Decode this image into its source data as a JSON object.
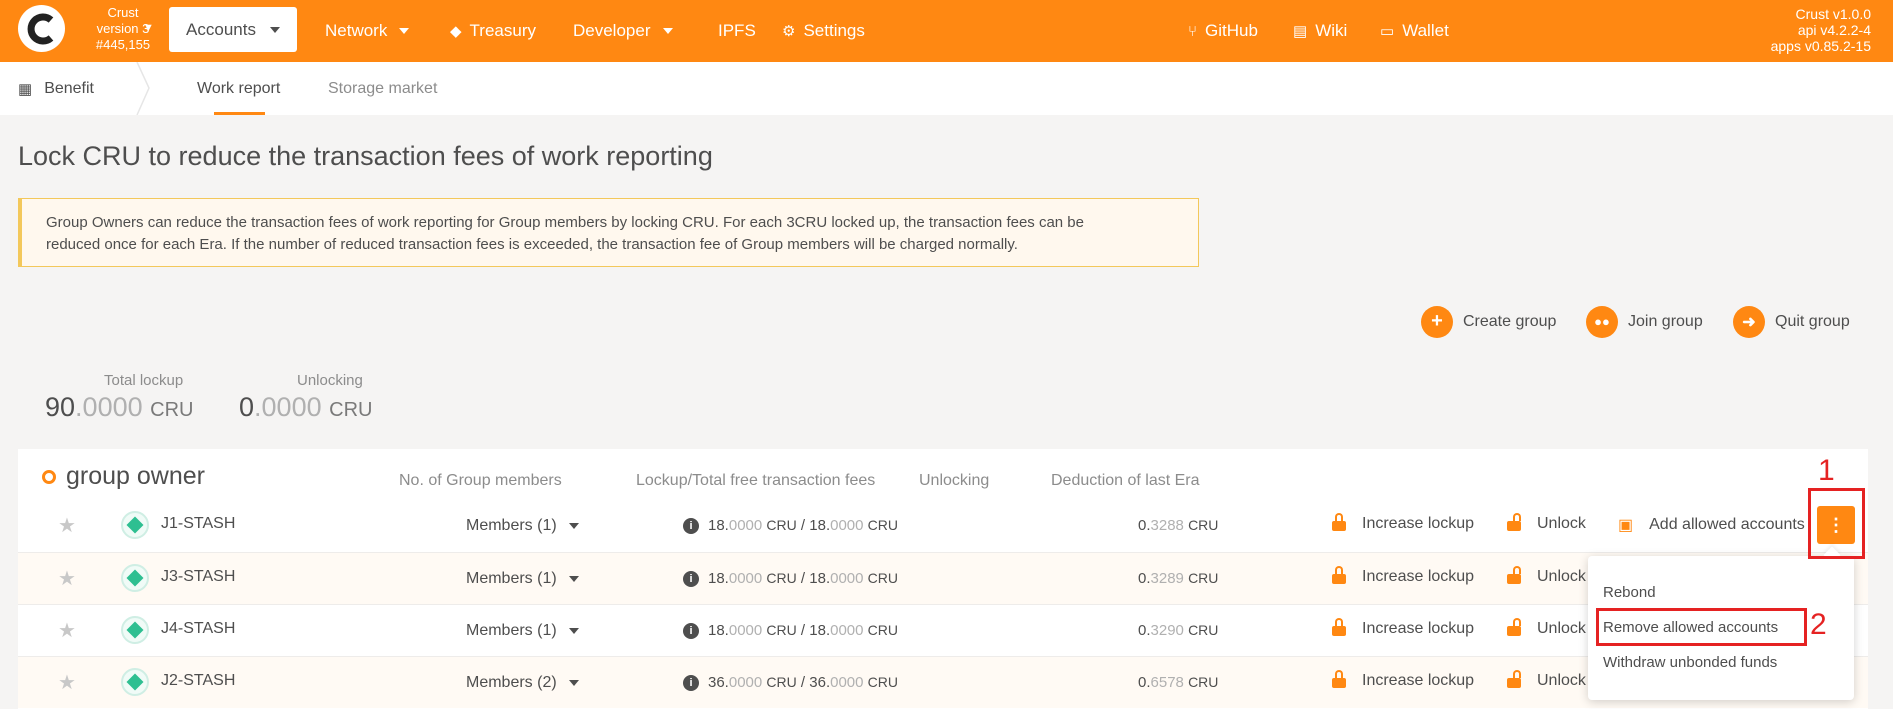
{
  "topbar": {
    "chain": {
      "name": "Crust",
      "version": "version 3",
      "block": "#445,155"
    },
    "nav": {
      "accounts": "Accounts",
      "network": "Network",
      "treasury": "Treasury",
      "developer": "Developer",
      "ipfs": "IPFS",
      "settings": "Settings",
      "github": "GitHub",
      "wiki": "Wiki",
      "wallet": "Wallet"
    },
    "version_info": {
      "crust": "Crust v1.0.0",
      "api": "api v4.2.2-4",
      "apps": "apps v0.85.2-15"
    },
    "accent_color": "#ff8812"
  },
  "subbar": {
    "section": "Benefit",
    "tabs": [
      "Work report",
      "Storage market"
    ],
    "active_tab": "Work report"
  },
  "page": {
    "title": "Lock CRU to reduce the transaction fees of work reporting",
    "notice_line1": "Group Owners can reduce the transaction fees of work reporting for Group members by locking CRU. For each 3CRU locked up, the transaction fees can be",
    "notice_line2": "reduced once for each Era. If the number of reduced transaction fees is exceeded, the transaction fee of Group members will be charged normally."
  },
  "actions": {
    "create": "Create group",
    "join": "Join group",
    "quit": "Quit group"
  },
  "summary": {
    "total_label": "Total lockup",
    "total_int": "90",
    "total_dec": ".0000",
    "unlocking_label": "Unlocking",
    "unlocking_int": "0",
    "unlocking_dec": ".0000",
    "unit": "CRU"
  },
  "table": {
    "group_title": "group owner",
    "headers": {
      "members": "No. of Group members",
      "lockup": "Lockup/Total free transaction fees",
      "unlocking": "Unlocking",
      "deduction": "Deduction of last Era"
    },
    "rows": [
      {
        "name": "J1-STASH",
        "members": "Members (1)",
        "lock_a": "18.",
        "lock_a_dec": "0000",
        "lock_b": "18.",
        "lock_b_dec": "0000",
        "ded_int": "0.",
        "ded_dec": "3288"
      },
      {
        "name": "J3-STASH",
        "members": "Members (1)",
        "lock_a": "18.",
        "lock_a_dec": "0000",
        "lock_b": "18.",
        "lock_b_dec": "0000",
        "ded_int": "0.",
        "ded_dec": "3289"
      },
      {
        "name": "J4-STASH",
        "members": "Members (1)",
        "lock_a": "18.",
        "lock_a_dec": "0000",
        "lock_b": "18.",
        "lock_b_dec": "0000",
        "ded_int": "0.",
        "ded_dec": "3290"
      },
      {
        "name": "J2-STASH",
        "members": "Members (2)",
        "lock_a": "36.",
        "lock_a_dec": "0000",
        "lock_b": "36.",
        "lock_b_dec": "0000",
        "ded_int": "0.",
        "ded_dec": "6578"
      }
    ],
    "unit": "CRU",
    "separator": " / ",
    "row_actions": {
      "increase": "Increase lockup",
      "unlock": "Unlock",
      "add_allowed": "Add allowed accounts"
    }
  },
  "dropdown": {
    "items": [
      "Rebond",
      "Remove allowed accounts",
      "Withdraw unbonded funds"
    ]
  },
  "annotations": {
    "label_1": "1",
    "label_2": "2",
    "color": "#e52222"
  }
}
